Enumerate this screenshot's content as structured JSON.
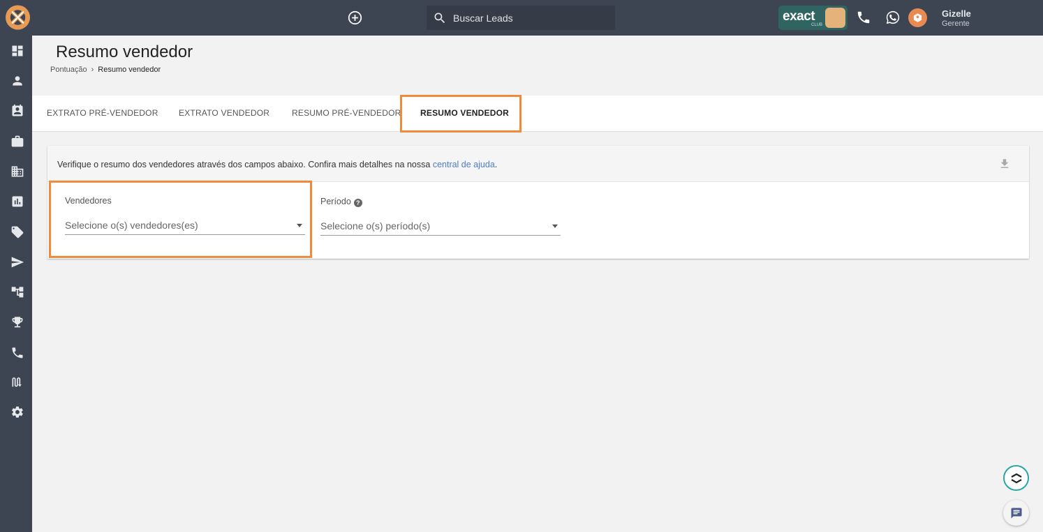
{
  "topbar": {
    "search_placeholder": "Buscar Leads",
    "exact_label": "exact",
    "exact_sub": "CLUB",
    "user_name": "Gizelle",
    "user_role": "Gerente"
  },
  "sidebar": {
    "items": [
      {
        "icon": "dashboard-icon"
      },
      {
        "icon": "person-icon"
      },
      {
        "icon": "contact-card-icon"
      },
      {
        "icon": "briefcase-icon"
      },
      {
        "icon": "building-icon"
      },
      {
        "icon": "report-icon"
      },
      {
        "icon": "tags-icon"
      },
      {
        "icon": "send-icon"
      },
      {
        "icon": "hierarchy-icon"
      },
      {
        "icon": "trophy-icon"
      },
      {
        "icon": "phone-icon"
      },
      {
        "icon": "flow-icon"
      },
      {
        "icon": "gear-icon"
      }
    ]
  },
  "page": {
    "title": "Resumo vendedor",
    "breadcrumb": [
      "Pontuação",
      "Resumo vendedor"
    ]
  },
  "tabs": [
    {
      "label": "EXTRATO PRÉ-VENDEDOR",
      "active": false
    },
    {
      "label": "EXTRATO VENDEDOR",
      "active": false
    },
    {
      "label": "RESUMO PRÉ-VENDEDOR",
      "active": false
    },
    {
      "label": "RESUMO VENDEDOR",
      "active": true
    }
  ],
  "card": {
    "info_text": "Verifique o resumo dos vendedores através dos campos abaixo. Confira mais detalhes na nossa ",
    "info_link": "central de ajuda",
    "info_end": ".",
    "fields": {
      "vendedores": {
        "label": "Vendedores",
        "placeholder": "Selecione o(s) vendedores(es)"
      },
      "periodo": {
        "label": "Período",
        "placeholder": "Selecione o(s) período(s)"
      }
    }
  },
  "colors": {
    "sidebar": "#3d4553",
    "highlight": "#f08a3c",
    "link": "#4f7dc2"
  }
}
